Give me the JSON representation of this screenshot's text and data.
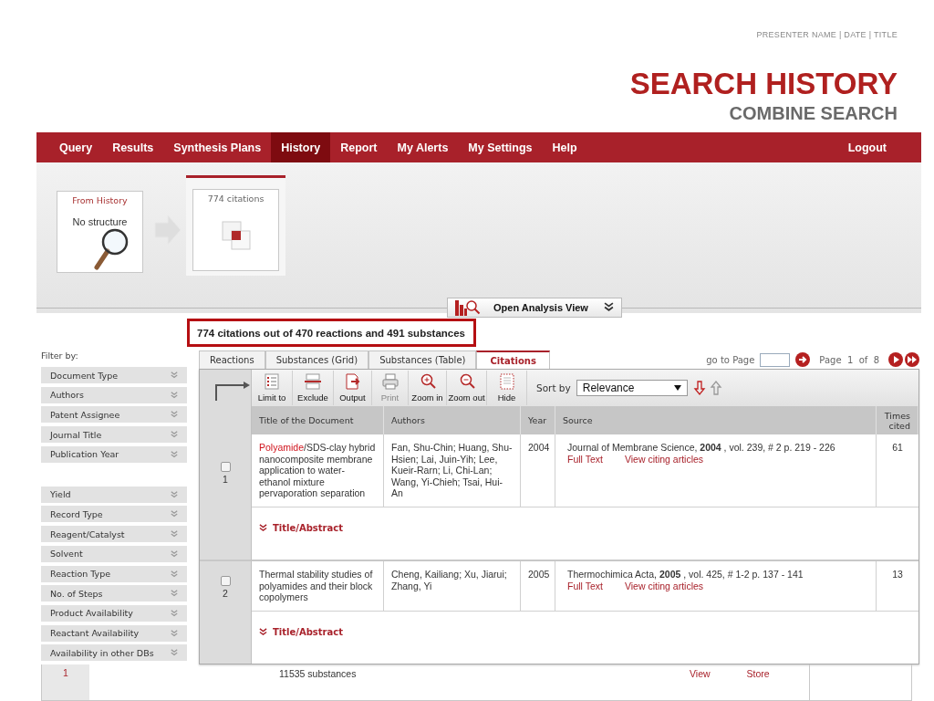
{
  "slide": {
    "header": "PRESENTER NAME | DATE | TITLE",
    "title": "SEARCH HISTORY",
    "subtitle": "COMBINE SEARCH"
  },
  "nav": {
    "items": [
      {
        "label": "Query",
        "selected": false
      },
      {
        "label": "Results",
        "selected": false
      },
      {
        "label": "Synthesis Plans",
        "selected": false
      },
      {
        "label": "History",
        "selected": true
      },
      {
        "label": "Report",
        "selected": false
      },
      {
        "label": "My Alerts",
        "selected": false
      },
      {
        "label": "My Settings",
        "selected": false
      },
      {
        "label": "Help",
        "selected": false
      }
    ],
    "logout": "Logout"
  },
  "history": {
    "cards": [
      {
        "kind": "query",
        "title": "From History",
        "text": "No structure",
        "selected": false
      },
      {
        "kind": "result",
        "title": "774 citations",
        "selected": true
      }
    ]
  },
  "analysis_button": "Open Analysis View",
  "summary": "774 citations out of 470 reactions and 491 substances",
  "filters": {
    "label": "Filter by:",
    "groups": [
      [
        {
          "label": "Document Type"
        },
        {
          "label": "Authors"
        },
        {
          "label": "Patent Assignee"
        },
        {
          "label": "Journal Title"
        },
        {
          "label": "Publication Year"
        }
      ],
      [
        {
          "label": "Yield"
        },
        {
          "label": "Record Type"
        },
        {
          "label": "Reagent/Catalyst"
        },
        {
          "label": "Solvent"
        },
        {
          "label": "Reaction Type"
        },
        {
          "label": "No. of Steps"
        },
        {
          "label": "Product Availability"
        },
        {
          "label": "Reactant Availability"
        },
        {
          "label": "Availability in other DBs"
        }
      ]
    ]
  },
  "result_tabs": [
    {
      "label": "Reactions",
      "selected": false
    },
    {
      "label": "Substances (Grid)",
      "selected": false
    },
    {
      "label": "Substances (Table)",
      "selected": false
    },
    {
      "label": "Citations",
      "selected": true
    }
  ],
  "pager": {
    "goto_label": "go to Page",
    "page": "Page  1  of  8"
  },
  "toolbar": [
    {
      "kind": "limit",
      "label": "Limit to",
      "disabled": false
    },
    {
      "kind": "exclude",
      "label": "Exclude",
      "disabled": false
    },
    {
      "kind": "output",
      "label": "Output",
      "disabled": false
    },
    {
      "kind": "print",
      "label": "Print",
      "disabled": true
    },
    {
      "kind": "zoom_in",
      "label": "Zoom in",
      "disabled": false
    },
    {
      "kind": "zoom_out",
      "label": "Zoom out",
      "disabled": false
    },
    {
      "kind": "hide",
      "label": "Hide",
      "disabled": false
    }
  ],
  "sort": {
    "label": "Sort by",
    "value": "Relevance"
  },
  "table": {
    "columns": [
      "Title of the Document",
      "Authors",
      "Year",
      "Source",
      "Times cited"
    ],
    "rows": [
      {
        "number": "1",
        "checked": false,
        "title_highlight": "Polyamide",
        "title": "/SDS-clay hybrid nanocomposite membrane application to water-ethanol mixture pervaporation separation",
        "authors": "Fan, Shu-Chin; Huang, Shu-Hsien; Lai, Juin-Yih; Lee, Kueir-Rarn; Li, Chi-Lan; Wang, Yi-Chieh; Tsai, Hui-An",
        "year": "2004",
        "source": "Journal of Membrane Science, **2004** ,  vol. 239,  # 2  p. 219 - 226",
        "links": [
          "Full Text",
          "View citing articles"
        ],
        "times_cited": "61",
        "abstract": "Title/Abstract"
      },
      {
        "number": "2",
        "checked": false,
        "title": "Thermal stability studies of polyamides and their block copolymers",
        "authors": "Cheng, Kailiang; Xu, Jiarui; Zhang, Yi",
        "year": "2005",
        "source": "Thermochimica Acta, **2005** ,  vol. 425,  # 1-2  p. 137 - 141",
        "links": [
          "Full Text",
          "View citing articles"
        ],
        "times_cited": "13",
        "abstract": "Title/Abstract"
      }
    ]
  },
  "background_row": {
    "number": "1",
    "text": "11535 substances",
    "links": [
      "View",
      "Store"
    ]
  }
}
